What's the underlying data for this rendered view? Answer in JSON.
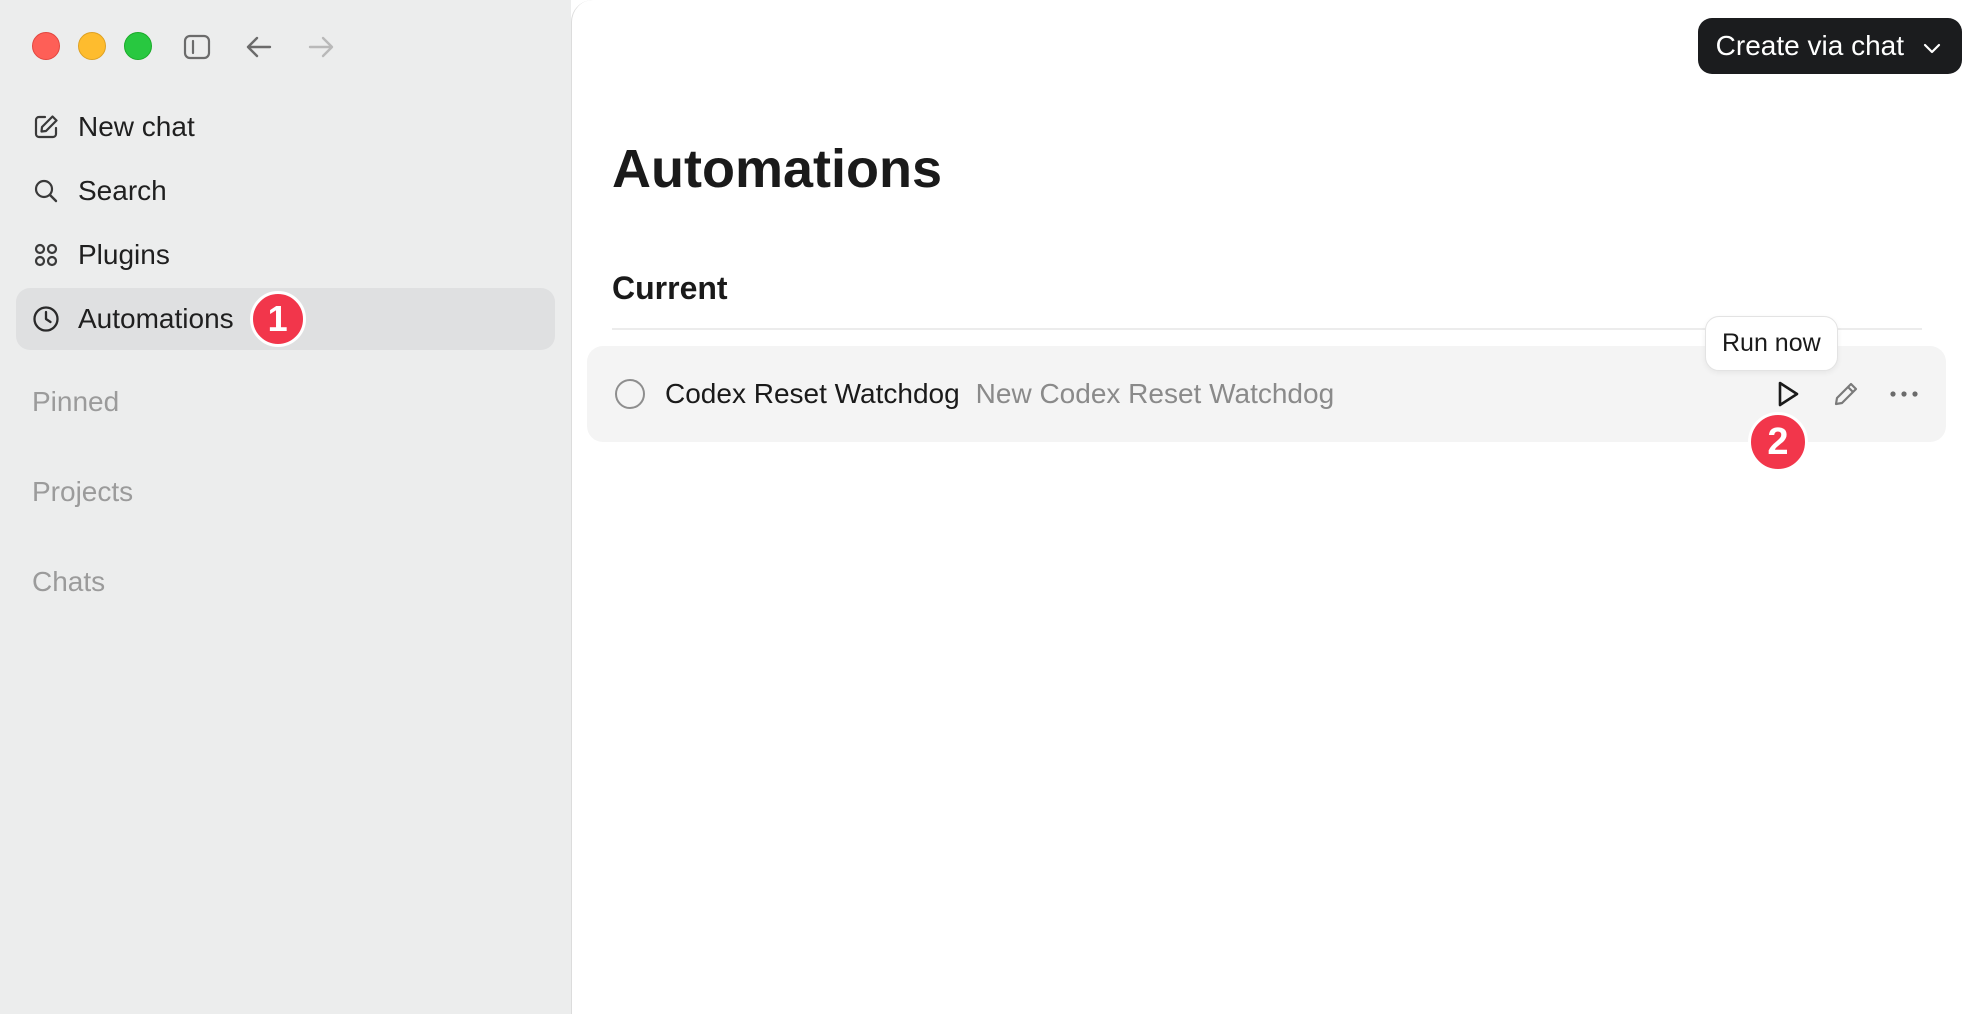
{
  "window": {
    "controls": [
      "close",
      "minimize",
      "maximize"
    ]
  },
  "sidebar": {
    "toolbar_icons": [
      "sidebar-toggle-icon",
      "back-arrow-icon",
      "forward-arrow-icon"
    ],
    "items": [
      {
        "label": "New chat",
        "icon": "compose-icon"
      },
      {
        "label": "Search",
        "icon": "search-icon"
      },
      {
        "label": "Plugins",
        "icon": "grid-icon"
      },
      {
        "label": "Automations",
        "icon": "clock-icon",
        "active": true,
        "badge": "1"
      }
    ],
    "sections": [
      "Pinned",
      "Projects",
      "Chats"
    ]
  },
  "header": {
    "create_label": "Create via chat"
  },
  "main": {
    "title": "Automations",
    "section": "Current",
    "automations": [
      {
        "name": "Codex Reset Watchdog",
        "description": "New Codex Reset Watchdog"
      }
    ],
    "tooltip": "Run now",
    "badge": "2"
  },
  "colors": {
    "sidebar_bg": "#eceded",
    "active_item_bg": "#dfe0e1",
    "badge": "#f2364b",
    "button_dark": "#1b1c1e",
    "row_bg": "#f4f4f4"
  }
}
